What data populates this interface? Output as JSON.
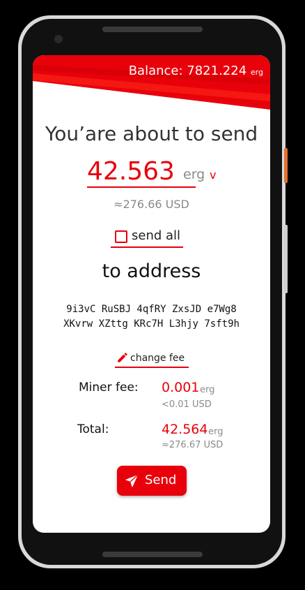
{
  "header": {
    "balance_label": "Balance:",
    "balance_value": "7821.224",
    "balance_unit": "erg"
  },
  "main": {
    "title": "You’are about to send",
    "amount": "42.563",
    "amount_unit": "erg",
    "amount_unit_dropdown": "v",
    "amount_usd": "≈276.66 USD",
    "send_all_label": "send all",
    "send_all_checked": false,
    "to_address_title": "to address",
    "address_line1": "9i3vC RuSBJ 4qfRY ZxsJD e7Wg8",
    "address_line2": "XKvrw XZttg KRc7H L3hjy 7sft9h",
    "change_fee_label": "change fee"
  },
  "fees": {
    "miner_fee_label": "Miner fee:",
    "miner_fee_value": "0.001",
    "miner_fee_unit": "erg",
    "miner_fee_usd": "<0.01 USD",
    "total_label": "Total:",
    "total_value": "42.564",
    "total_unit": "erg",
    "total_usd": "≈276.67 USD"
  },
  "actions": {
    "send_label": "Send"
  },
  "colors": {
    "accent": "#e8000b",
    "muted": "#8a8a8a"
  },
  "icons": {
    "checkbox": "checkbox-icon",
    "pencil": "pencil-icon",
    "send": "paper-plane-icon"
  }
}
